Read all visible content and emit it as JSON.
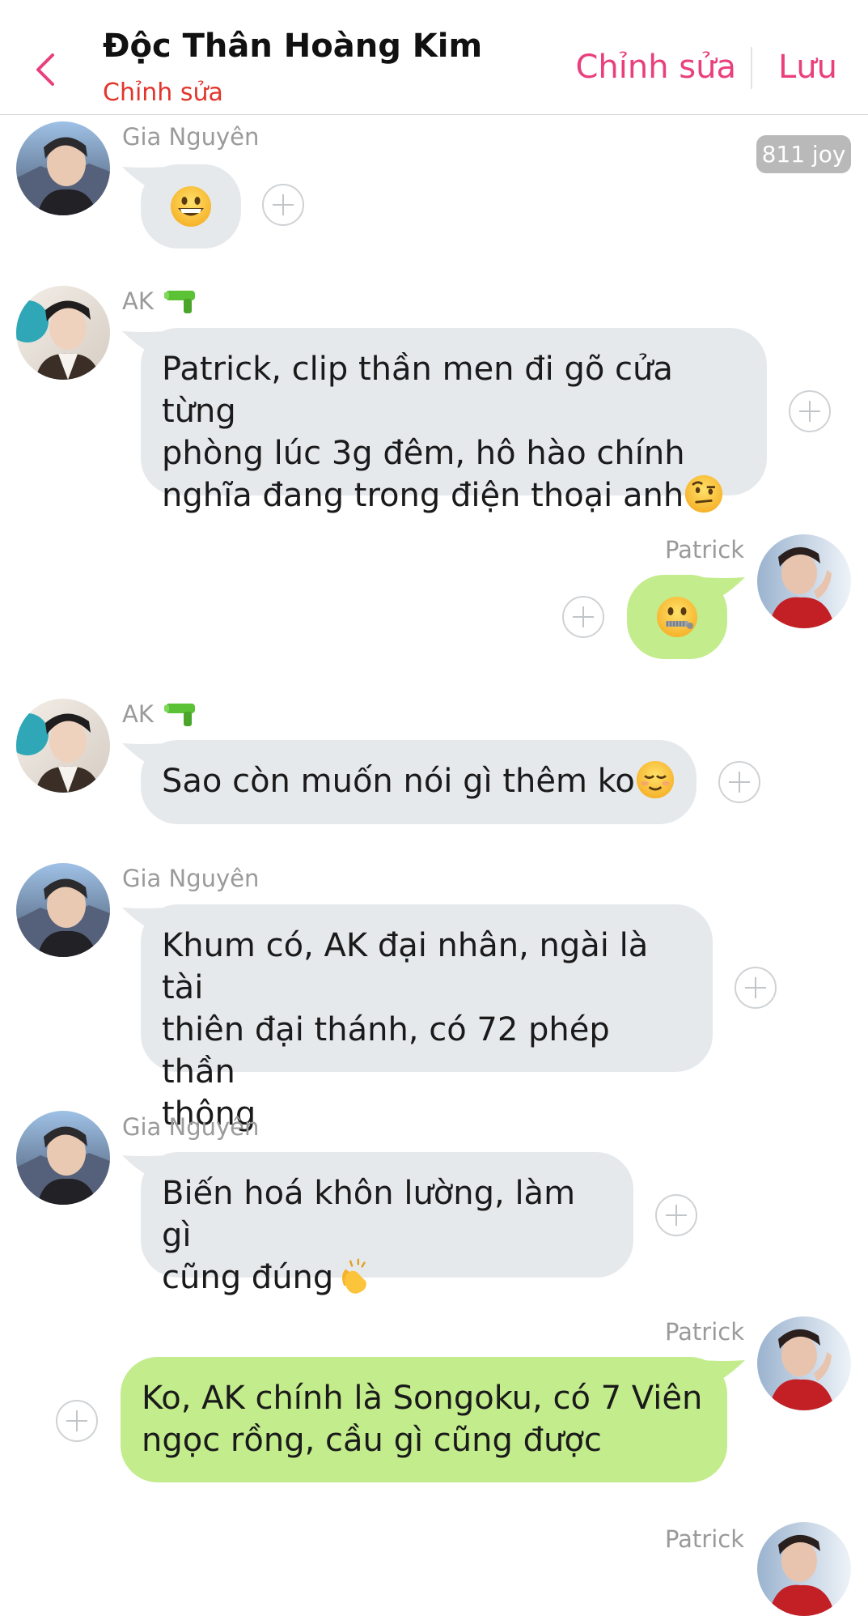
{
  "header": {
    "title": "Độc Thân Hoàng Kim",
    "subtitle": "Chỉnh sửa",
    "edit_label": "Chỉnh sửa",
    "save_label": "Lưu",
    "accent_color": "#e9407d",
    "subtitle_color": "#e2352c"
  },
  "badge": {
    "label": "811 joy"
  },
  "messages": [
    {
      "sender": "Gia Nguyên",
      "side": "left",
      "text": "",
      "emoji": "grinning-face"
    },
    {
      "sender": "AK",
      "sender_icon": "water-pistol",
      "side": "left",
      "text": "Patrick, clip thần men đi gõ cửa từng\nphòng lúc 3g đêm, hô hào chính\nnghĩa đang trong điện thoại anh",
      "emoji": "face-with-raised-eyebrow"
    },
    {
      "sender": "Patrick",
      "side": "right",
      "text": "",
      "emoji": "zipper-mouth-face"
    },
    {
      "sender": "AK",
      "sender_icon": "water-pistol",
      "side": "left",
      "text": "Sao còn muốn nói gì thêm ko",
      "emoji": "relieved-face"
    },
    {
      "sender": "Gia Nguyên",
      "side": "left",
      "text": "Khum có, AK đại nhân, ngài là tài\nthiên đại thánh, có 72 phép thần\nthông"
    },
    {
      "sender": "Gia Nguyên",
      "side": "left",
      "text": "Biến hoá khôn lường, làm gì\ncũng đúng",
      "emoji": "clapping-hands"
    },
    {
      "sender": "Patrick",
      "side": "right",
      "text": "Ko, AK chính là Songoku, có 7 Viên\nngọc rồng, cầu gì cũng được"
    },
    {
      "sender": "Patrick",
      "side": "right",
      "text": ""
    }
  ],
  "colors": {
    "bubble_gray": "#e6e9ec",
    "bubble_green": "#c3ec8c",
    "sender_gray": "#9a9a9a"
  }
}
